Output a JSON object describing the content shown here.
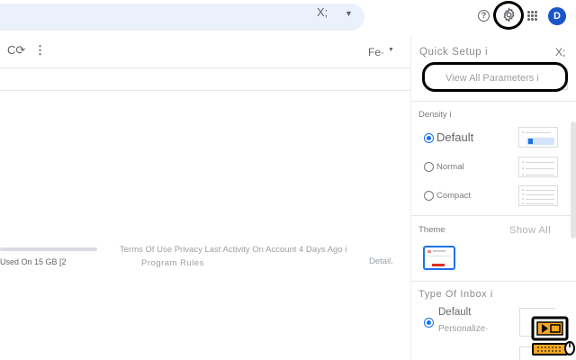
{
  "header": {
    "search_clear_icon": "close-icon",
    "search_options_icon": "caret-down-icon",
    "help_icon": "help-icon",
    "settings_icon": "gear-icon",
    "apps_icon": "apps-grid-icon",
    "avatar_initial": "D",
    "avatar_color": "#1a56c8"
  },
  "toolbar": {
    "refresh_glyph": "C⟳",
    "more_glyph": "⋮",
    "sort_label": "Fe·",
    "sort_caret": "▼"
  },
  "footer": {
    "storage_text": "Used On 15 GB [2",
    "line1": "Terms Of Use Privacy Last Activity On Account 4 Days Ago i",
    "line2": "Program   Rules",
    "details": "Detail."
  },
  "quick_settings": {
    "title": "Quick Setup i",
    "close_glyph": "X;",
    "view_all_label": "View All Parameters i",
    "density": {
      "title": "Density i",
      "options": [
        {
          "label": "Default",
          "selected": true
        },
        {
          "label": "Normal",
          "selected": false
        },
        {
          "label": "Compact",
          "selected": false
        }
      ]
    },
    "theme": {
      "title": "Theme",
      "show_all": "Show All"
    },
    "inbox_type": {
      "title": "Type Of Inbox i",
      "option_label": "Default",
      "option_sublabel": "Personalize·"
    }
  },
  "colors": {
    "accent": "#1a73e8",
    "highlight": "#000000"
  }
}
